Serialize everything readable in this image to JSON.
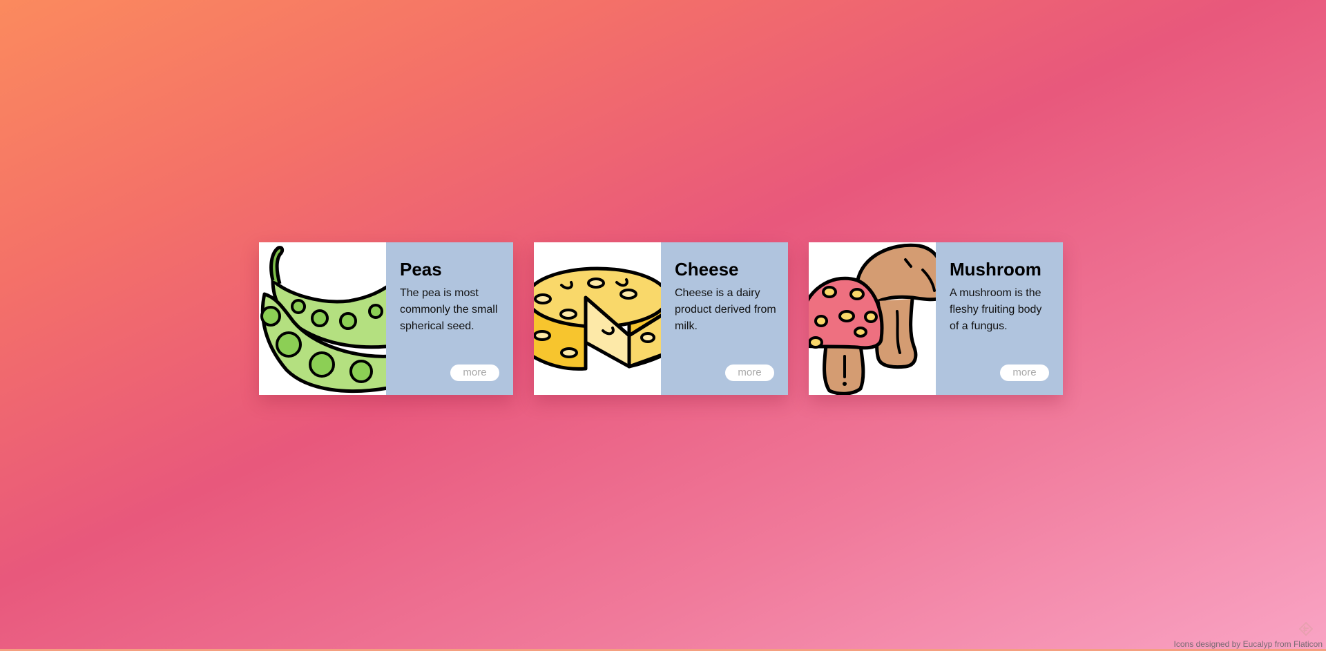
{
  "cards": [
    {
      "title": "Peas",
      "description": "The pea is most commonly the small spherical seed.",
      "button_label": "more",
      "icon": "peas-icon",
      "background": "#b0c4de"
    },
    {
      "title": "Cheese",
      "description": "Cheese is a dairy product derived from milk.",
      "button_label": "more",
      "icon": "cheese-icon",
      "background": "#b0c4de"
    },
    {
      "title": "Mushroom",
      "description": "A mushroom is the fleshy fruiting body of a fungus.",
      "button_label": "more",
      "icon": "mushroom-icon",
      "background": "#b0c4de"
    }
  ],
  "footer": {
    "credit": "Icons designed by Eucalyp from Flaticon",
    "logo_icon": "flaticon-logo-icon"
  },
  "colors": {
    "gradient_start": "#fb8a5e",
    "gradient_mid": "#e8587c",
    "gradient_end": "#f9a4c4",
    "card_body": "#b0c4de"
  }
}
